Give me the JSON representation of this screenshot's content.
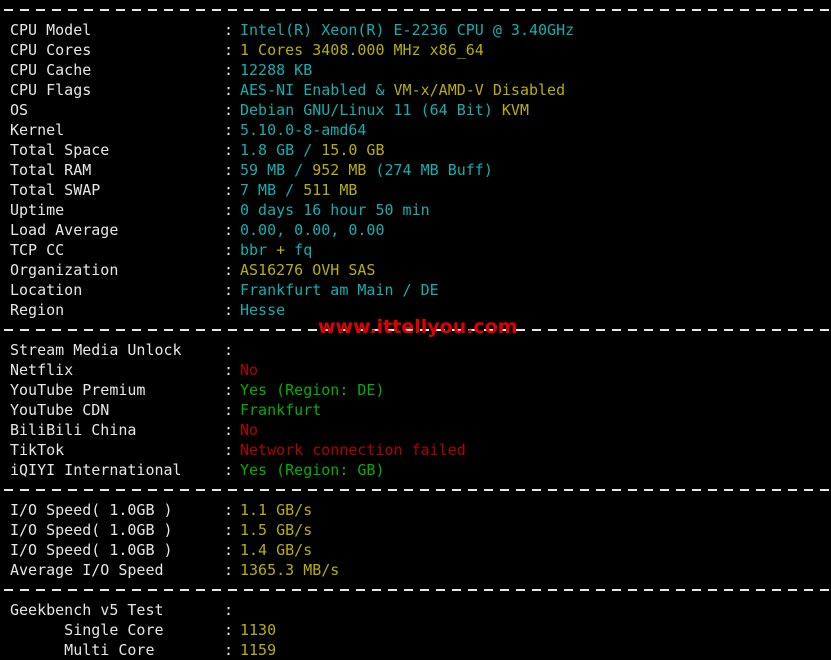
{
  "terminal": {
    "background_color": "#000000",
    "default_text_color": "#e6e6e6",
    "colors": {
      "cyan": "#10b0b0",
      "yellow": "#b8b000",
      "green": "#00b000",
      "red": "#b00000",
      "white": "#e6e6e6",
      "watermark_red": "#e00000"
    },
    "colon": ":"
  },
  "watermark": {
    "text": "www.ittellyou.com"
  },
  "sections": {
    "system": {
      "rows": [
        {
          "label": "CPU Model",
          "parts": [
            {
              "text": "Intel(R) Xeon(R) E-2236 CPU @ 3.40GHz",
              "color": "cyan"
            }
          ]
        },
        {
          "label": "CPU Cores",
          "parts": [
            {
              "text": "1 Cores 3408.000 MHz x86_64",
              "color": "yellow"
            }
          ]
        },
        {
          "label": "CPU Cache",
          "parts": [
            {
              "text": "12288 KB",
              "color": "cyan"
            }
          ]
        },
        {
          "label": "CPU Flags",
          "parts": [
            {
              "text": "AES-NI Enabled & ",
              "color": "cyan"
            },
            {
              "text": "VM-x/AMD-V Disabled",
              "color": "yellow"
            }
          ]
        },
        {
          "label": "OS",
          "parts": [
            {
              "text": "Debian GNU/Linux 11 (64 Bit) ",
              "color": "cyan"
            },
            {
              "text": "KVM",
              "color": "yellow"
            }
          ]
        },
        {
          "label": "Kernel",
          "parts": [
            {
              "text": "5.10.0-8-amd64",
              "color": "cyan"
            }
          ]
        },
        {
          "label": "Total Space",
          "parts": [
            {
              "text": "1.8 GB / ",
              "color": "cyan"
            },
            {
              "text": "15.0 GB",
              "color": "yellow"
            }
          ]
        },
        {
          "label": "Total RAM",
          "parts": [
            {
              "text": "59 MB / ",
              "color": "cyan"
            },
            {
              "text": "952 MB",
              "color": "yellow"
            },
            {
              "text": " (274 MB Buff)",
              "color": "cyan"
            }
          ]
        },
        {
          "label": "Total SWAP",
          "parts": [
            {
              "text": "7 MB / ",
              "color": "cyan"
            },
            {
              "text": "511 MB",
              "color": "yellow"
            }
          ]
        },
        {
          "label": "Uptime",
          "parts": [
            {
              "text": "0 days 16 hour 50 min",
              "color": "cyan"
            }
          ]
        },
        {
          "label": "Load Average",
          "parts": [
            {
              "text": "0.00, 0.00, 0.00",
              "color": "cyan"
            }
          ]
        },
        {
          "label": "TCP CC",
          "parts": [
            {
              "text": "bbr ",
              "color": "cyan"
            },
            {
              "text": "+",
              "color": "yellow"
            },
            {
              "text": " fq",
              "color": "cyan"
            }
          ]
        },
        {
          "label": "Organization",
          "parts": [
            {
              "text": "AS16276 OVH SAS",
              "color": "yellow"
            }
          ]
        },
        {
          "label": "Location",
          "parts": [
            {
              "text": "Frankfurt am Main / DE",
              "color": "cyan"
            }
          ]
        },
        {
          "label": "Region",
          "parts": [
            {
              "text": "Hesse",
              "color": "cyan"
            }
          ]
        }
      ]
    },
    "stream_media": {
      "rows": [
        {
          "label": "Stream Media Unlock",
          "parts": []
        },
        {
          "label": "Netflix",
          "parts": [
            {
              "text": "No",
              "color": "red"
            }
          ]
        },
        {
          "label": "YouTube Premium",
          "parts": [
            {
              "text": "Yes (Region: DE)",
              "color": "green"
            }
          ]
        },
        {
          "label": "YouTube CDN",
          "parts": [
            {
              "text": "Frankfurt",
              "color": "green"
            }
          ]
        },
        {
          "label": "BiliBili China",
          "parts": [
            {
              "text": "No",
              "color": "red"
            }
          ]
        },
        {
          "label": "TikTok",
          "parts": [
            {
              "text": "Network connection failed",
              "color": "red"
            }
          ]
        },
        {
          "label": "iQIYI International",
          "parts": [
            {
              "text": "Yes (Region: GB)",
              "color": "green"
            }
          ]
        }
      ]
    },
    "io_speed": {
      "rows": [
        {
          "label": "I/O Speed( 1.0GB )",
          "parts": [
            {
              "text": "1.1 GB/s",
              "color": "yellow"
            }
          ]
        },
        {
          "label": "I/O Speed( 1.0GB )",
          "parts": [
            {
              "text": "1.5 GB/s",
              "color": "yellow"
            }
          ]
        },
        {
          "label": "I/O Speed( 1.0GB )",
          "parts": [
            {
              "text": "1.4 GB/s",
              "color": "yellow"
            }
          ]
        },
        {
          "label": "Average I/O Speed",
          "parts": [
            {
              "text": "1365.3 MB/s",
              "color": "yellow"
            }
          ]
        }
      ]
    },
    "geekbench": {
      "rows": [
        {
          "label": "Geekbench v5 Test",
          "parts": []
        },
        {
          "label": "      Single Core",
          "parts": [
            {
              "text": "1130",
              "color": "yellow"
            }
          ]
        },
        {
          "label": "      Multi Core",
          "parts": [
            {
              "text": "1159",
              "color": "yellow"
            }
          ]
        }
      ]
    }
  }
}
